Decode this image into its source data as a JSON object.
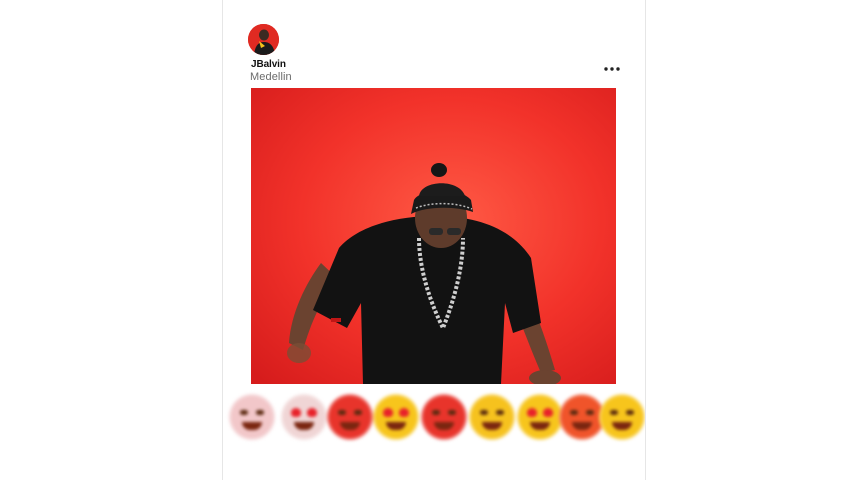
{
  "post": {
    "username": "JBalvin",
    "location": "Medellin",
    "more_label": "..."
  },
  "colors": {
    "photo_background": "#f4302b",
    "avatar_background": "#e02a22",
    "emoji_yellow": "#f7c51c",
    "emoji_red": "#e8342b"
  },
  "reactions": [
    {
      "icon": "grinning-face-icon"
    },
    {
      "icon": "heart-eyes-face-icon"
    },
    {
      "icon": "grinning-face-icon"
    },
    {
      "icon": "heart-eyes-face-icon"
    },
    {
      "icon": "smiling-face-icon"
    },
    {
      "icon": "grinning-face-icon"
    },
    {
      "icon": "heart-eyes-face-icon"
    },
    {
      "icon": "grinning-face-icon"
    },
    {
      "icon": "smiling-face-icon"
    }
  ]
}
